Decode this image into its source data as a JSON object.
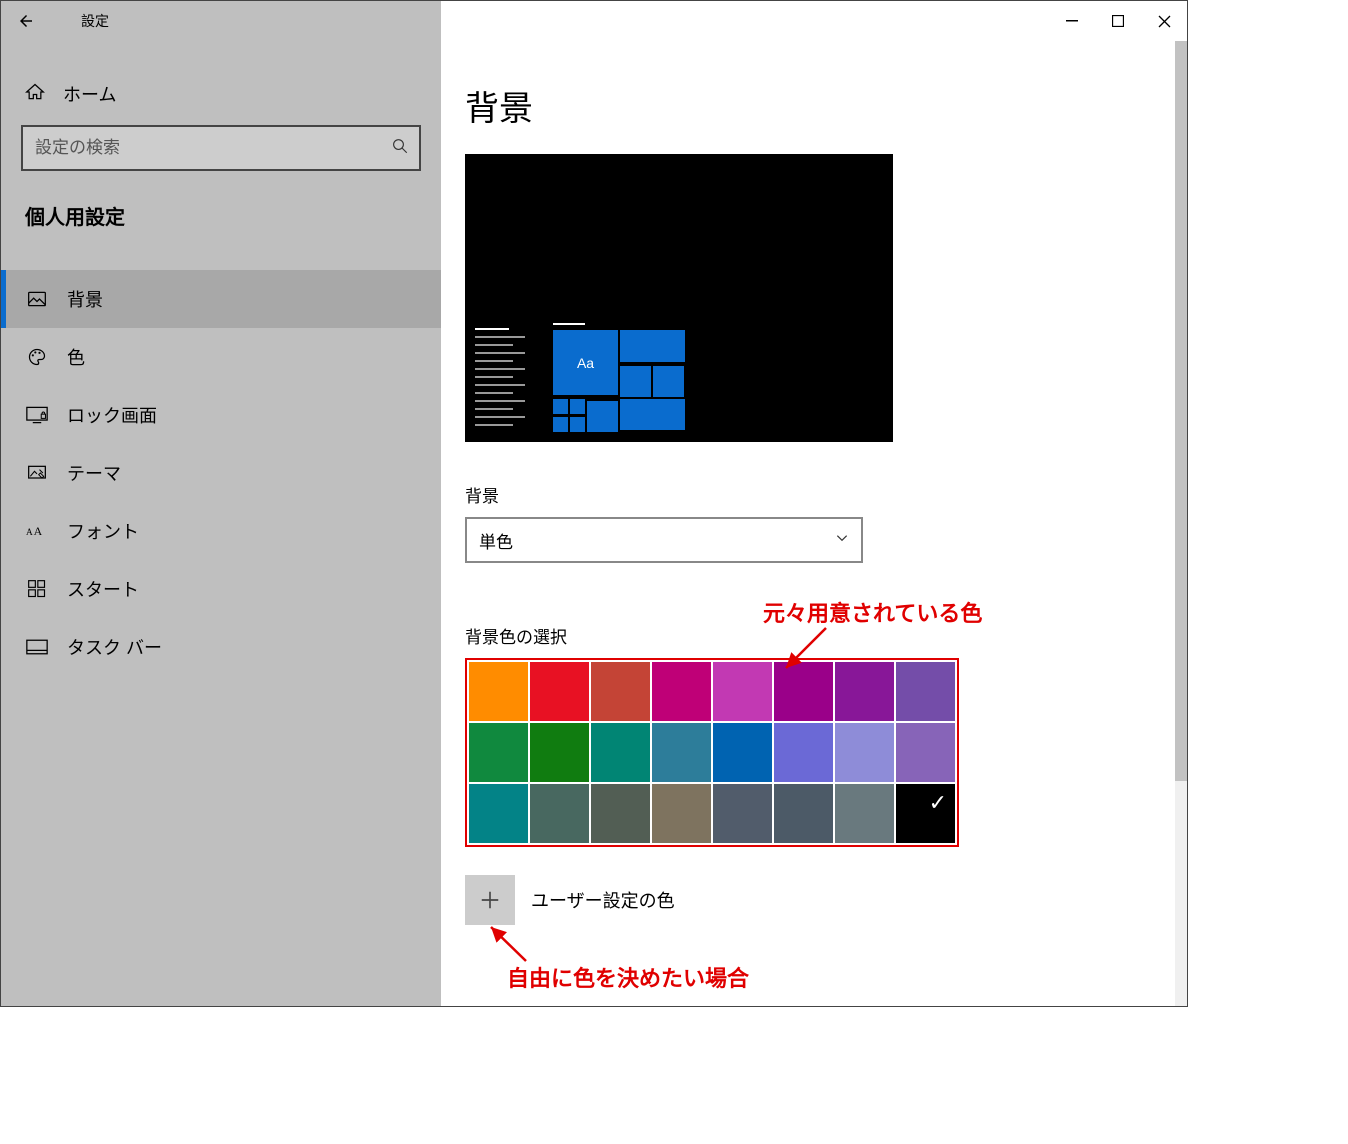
{
  "window": {
    "title": "設定"
  },
  "sidebar": {
    "home": "ホーム",
    "search_placeholder": "設定の検索",
    "section": "個人用設定",
    "items": [
      {
        "label": "背景"
      },
      {
        "label": "色"
      },
      {
        "label": "ロック画面"
      },
      {
        "label": "テーマ"
      },
      {
        "label": "フォント"
      },
      {
        "label": "スタート"
      },
      {
        "label": "タスク バー"
      }
    ]
  },
  "content": {
    "heading": "背景",
    "preview_sample_text": "Aa",
    "bg_label": "背景",
    "bg_dropdown_value": "単色",
    "palette_label": "背景色の選択",
    "colors_row1": [
      "#ff8c00",
      "#e81123",
      "#c44436",
      "#bf0077",
      "#c239b3",
      "#9a0089",
      "#881798",
      "#744da9"
    ],
    "colors_row2": [
      "#10893e",
      "#107c10",
      "#018574",
      "#2d7d9a",
      "#0063b1",
      "#6b69d6",
      "#8e8cd8",
      "#8764b8"
    ],
    "colors_row3": [
      "#038387",
      "#486860",
      "#525e54",
      "#7e735f",
      "#515c6b",
      "#4c5a67",
      "#69797e",
      "#000000"
    ],
    "selected_color_index": 23,
    "custom_color_label": "ユーザー設定の色"
  },
  "annotations": {
    "prepared": "元々用意されている色",
    "freeform": "自由に色を決めたい場合"
  }
}
